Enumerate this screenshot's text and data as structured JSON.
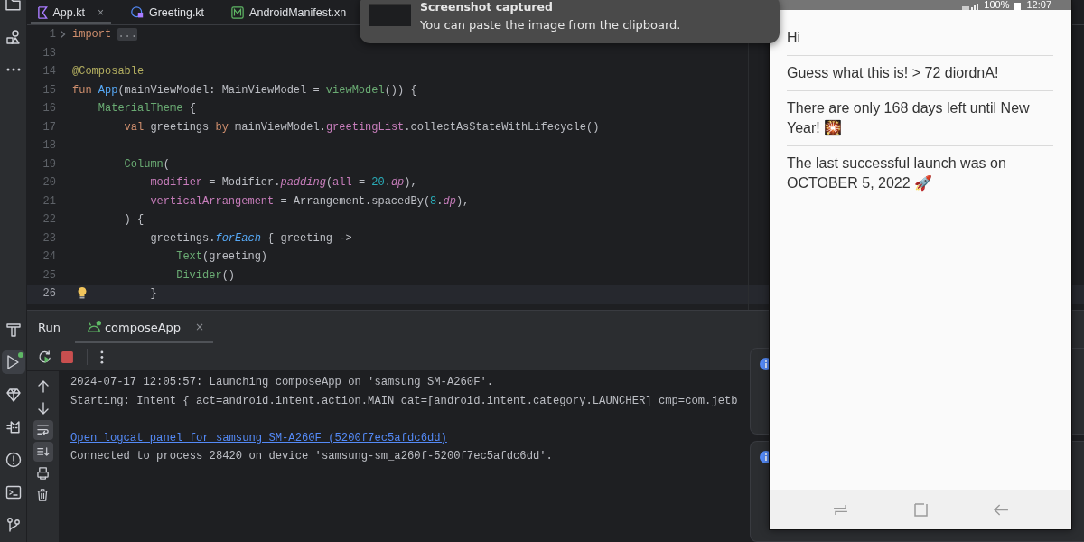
{
  "tool_strip": {
    "top": [
      {
        "kind": "folder",
        "selected": false
      },
      {
        "kind": "shapes",
        "selected": false
      },
      {
        "kind": "more",
        "selected": false
      }
    ],
    "bottom": [
      {
        "kind": "hammer",
        "selected": false
      },
      {
        "kind": "run",
        "selected": true
      },
      {
        "kind": "gem",
        "selected": false
      },
      {
        "kind": "cat",
        "selected": false
      },
      {
        "kind": "warning",
        "selected": false
      },
      {
        "kind": "terminal",
        "selected": false
      },
      {
        "kind": "git",
        "selected": false
      }
    ]
  },
  "editor_tabs": [
    {
      "label": "App.kt",
      "kind": "kotlin",
      "selected": true,
      "close": "×"
    },
    {
      "label": "Greeting.kt",
      "kind": "kotlinclass",
      "selected": false
    },
    {
      "label": "AndroidManifest.xn",
      "kind": "manifest",
      "selected": false
    }
  ],
  "code_lines": [
    {
      "number": "1",
      "fold": true,
      "current": false,
      "tokens": [
        {
          "kind": "keyword",
          "text": "import "
        },
        {
          "kind": "folded",
          "text": "..."
        }
      ]
    },
    {
      "number": "13",
      "fold": false,
      "current": false
    },
    {
      "number": "14",
      "fold": false,
      "current": false,
      "tokens": [
        {
          "kind": "annotation",
          "text": "@Composable"
        }
      ]
    },
    {
      "number": "15",
      "fold": false,
      "current": false,
      "tokens": [
        {
          "kind": "keyword",
          "text": "fun "
        },
        {
          "kind": "declaration",
          "text": "App"
        },
        {
          "kind": "plain",
          "text": "(mainViewModel: MainViewModel = "
        },
        {
          "kind": "composable",
          "text": "viewModel"
        },
        {
          "kind": "plain",
          "text": "()) {"
        }
      ]
    },
    {
      "number": "16",
      "fold": false,
      "current": false,
      "tokens": [
        {
          "kind": "composable",
          "text": "    MaterialTheme"
        },
        {
          "kind": "plain",
          "text": " {"
        }
      ]
    },
    {
      "number": "17",
      "fold": false,
      "current": false,
      "tokens": [
        {
          "kind": "keyword",
          "text": "        val"
        },
        {
          "kind": "plain",
          "text": " greetings "
        },
        {
          "kind": "keyword",
          "text": "by"
        },
        {
          "kind": "plain",
          "text": " mainViewModel."
        },
        {
          "kind": "named",
          "text": "greetingList"
        },
        {
          "kind": "plain",
          "text": ".collectAsStateWithLifecycle()"
        }
      ]
    },
    {
      "number": "18",
      "fold": false,
      "current": false
    },
    {
      "number": "19",
      "fold": false,
      "current": false,
      "tokens": [
        {
          "kind": "composable",
          "text": "        Column"
        },
        {
          "kind": "plain",
          "text": "("
        }
      ]
    },
    {
      "number": "20",
      "fold": false,
      "current": false,
      "tokens": [
        {
          "kind": "named",
          "text": "            modifier"
        },
        {
          "kind": "plain",
          "text": " = Modifier."
        },
        {
          "kind": "extensionnamed",
          "text": "padding"
        },
        {
          "kind": "plain",
          "text": "("
        },
        {
          "kind": "named",
          "text": "all"
        },
        {
          "kind": "plain",
          "text": " = "
        },
        {
          "kind": "number",
          "text": "20"
        },
        {
          "kind": "plain",
          "text": "."
        },
        {
          "kind": "extensionnamed",
          "text": "dp"
        },
        {
          "kind": "plain",
          "text": "),"
        }
      ]
    },
    {
      "number": "21",
      "fold": false,
      "current": false,
      "tokens": [
        {
          "kind": "named",
          "text": "            verticalArrangement"
        },
        {
          "kind": "plain",
          "text": " = Arrangement.spacedBy("
        },
        {
          "kind": "number",
          "text": "8"
        },
        {
          "kind": "plain",
          "text": "."
        },
        {
          "kind": "extensionnamed",
          "text": "dp"
        },
        {
          "kind": "plain",
          "text": "),"
        }
      ]
    },
    {
      "number": "22",
      "fold": false,
      "current": false,
      "tokens": [
        {
          "kind": "plain",
          "text": "        ) {"
        }
      ]
    },
    {
      "number": "23",
      "fold": false,
      "current": false,
      "tokens": [
        {
          "kind": "plain",
          "text": "            greetings."
        },
        {
          "kind": "extension",
          "text": "forEach"
        },
        {
          "kind": "plain",
          "text": " { greeting ->"
        }
      ]
    },
    {
      "number": "24",
      "fold": false,
      "current": false,
      "tokens": [
        {
          "kind": "composable",
          "text": "                Text"
        },
        {
          "kind": "plain",
          "text": "(greeting)"
        }
      ]
    },
    {
      "number": "25",
      "fold": false,
      "current": false,
      "tokens": [
        {
          "kind": "composable",
          "text": "                Divider"
        },
        {
          "kind": "plain",
          "text": "()"
        }
      ]
    },
    {
      "number": "26",
      "fold": false,
      "current": true,
      "tokens": [
        {
          "kind": "plain",
          "text": "            }"
        }
      ]
    }
  ],
  "run_panel": {
    "title": "Run",
    "tabs": [
      {
        "label": "composeApp",
        "selected": true,
        "close": "×"
      }
    ],
    "toolbar": [
      {
        "kind": "rerun"
      },
      {
        "kind": "stop"
      },
      {
        "kind": "more"
      }
    ],
    "side_tools": [
      {
        "kind": "up",
        "on": false
      },
      {
        "kind": "down",
        "on": false
      },
      {
        "kind": "wrap",
        "on": true
      },
      {
        "kind": "scrollend",
        "on": true
      },
      {
        "kind": "print",
        "on": false
      },
      {
        "kind": "trash",
        "on": false
      }
    ],
    "console": [
      {
        "kind": "text",
        "text": "2024-07-17 12:05:57: Launching composeApp on 'samsung SM-A260F'."
      },
      {
        "kind": "text",
        "text": "Starting: Intent { act=android.intent.action.MAIN cat=[android.intent.category.LAUNCHER] cmp=com.jetb"
      },
      {
        "kind": "gap"
      },
      {
        "kind": "link",
        "text": "Open logcat panel for samsung SM-A260F (5200f7ec5afdc6dd)"
      },
      {
        "kind": "text",
        "text": "Connected to process 28420 on device 'samsung-sm_a260f-5200f7ec5afdc6dd'."
      }
    ]
  },
  "notifications": [
    {
      "kind": "info"
    },
    {
      "kind": "info"
    }
  ],
  "toast": {
    "title": "Screenshot captured",
    "message": "You can paste the image from the clipboard."
  },
  "phone": {
    "battery": "100%",
    "time": "12:07",
    "greetings": [
      "Hi",
      "Guess what this is! > 72 diordnA!",
      "There are only 168 days left until New Year! 🎇",
      "The last successful launch was on OCTOBER 5, 2022 🚀"
    ]
  }
}
